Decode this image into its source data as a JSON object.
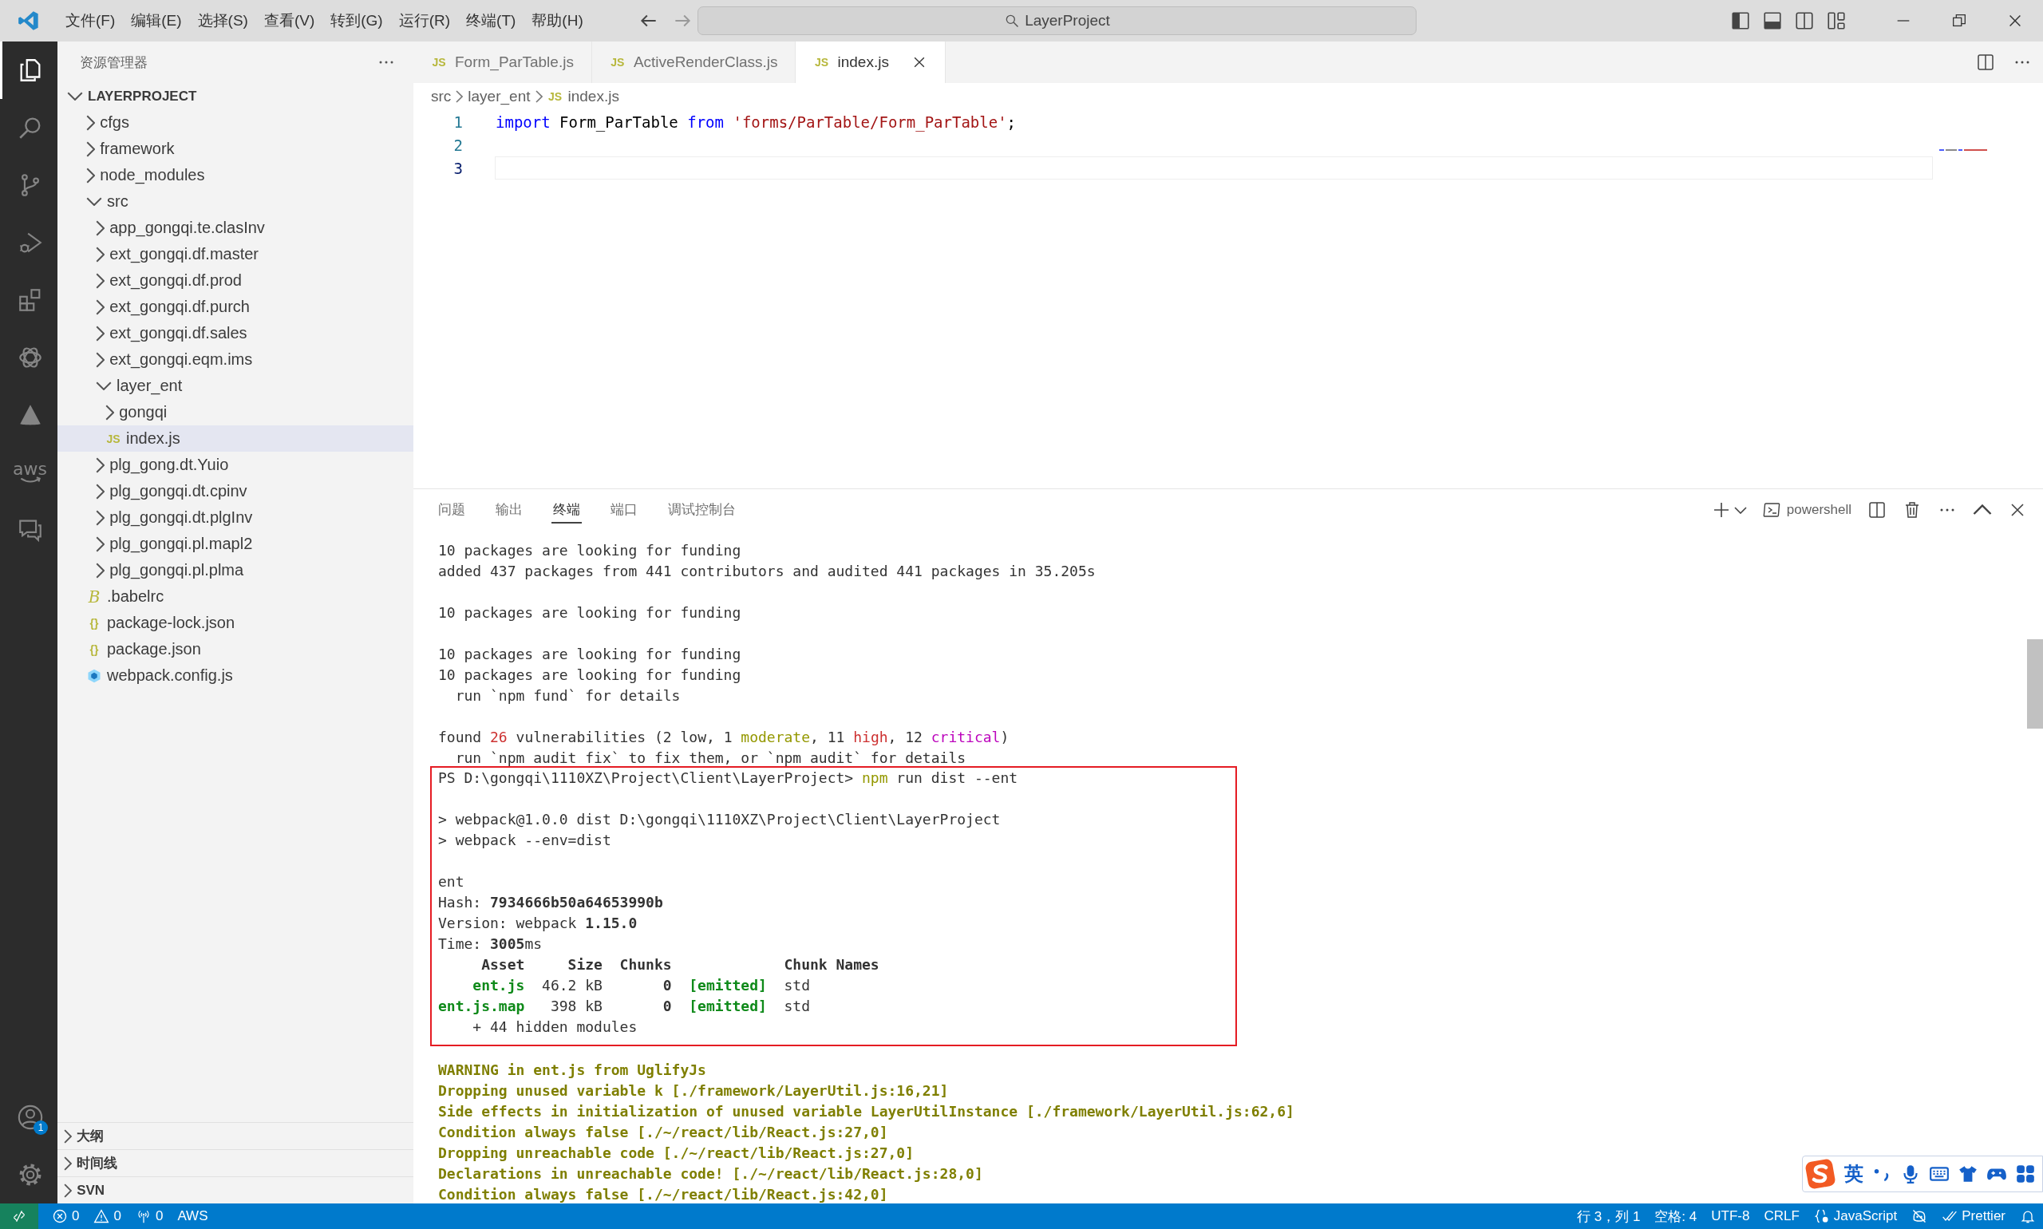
{
  "title_bar": {
    "menus": [
      "文件(F)",
      "编辑(E)",
      "选择(S)",
      "查看(V)",
      "转到(G)",
      "运行(R)",
      "终端(T)",
      "帮助(H)"
    ],
    "command_center": "LayerProject"
  },
  "activity_bar": {
    "items": [
      {
        "kind": "explorer",
        "selected": true
      },
      {
        "kind": "search",
        "selected": false
      },
      {
        "kind": "source-control",
        "selected": false
      },
      {
        "kind": "run-debug",
        "selected": false
      },
      {
        "kind": "extensions",
        "selected": false
      },
      {
        "kind": "knot",
        "selected": false
      },
      {
        "kind": "cone",
        "selected": false
      },
      {
        "kind": "aws",
        "label": "aws",
        "selected": false
      },
      {
        "kind": "chat",
        "selected": false
      }
    ],
    "account_badge": "1"
  },
  "sidebar": {
    "title": "资源管理器",
    "root": {
      "label": "LAYERPROJECT",
      "kind": "folder",
      "expanded": true,
      "selected": false,
      "children": [
        {
          "label": "cfgs",
          "kind": "folder",
          "expanded": false,
          "selected": false
        },
        {
          "label": "framework",
          "kind": "folder",
          "expanded": false,
          "selected": false
        },
        {
          "label": "node_modules",
          "kind": "folder",
          "expanded": false,
          "selected": false
        },
        {
          "label": "src",
          "kind": "folder",
          "expanded": true,
          "selected": false,
          "children": [
            {
              "label": "app_gongqi.te.clasInv",
              "kind": "folder",
              "expanded": false,
              "selected": false
            },
            {
              "label": "ext_gongqi.df.master",
              "kind": "folder",
              "expanded": false,
              "selected": false
            },
            {
              "label": "ext_gongqi.df.prod",
              "kind": "folder",
              "expanded": false,
              "selected": false
            },
            {
              "label": "ext_gongqi.df.purch",
              "kind": "folder",
              "expanded": false,
              "selected": false
            },
            {
              "label": "ext_gongqi.df.sales",
              "kind": "folder",
              "expanded": false,
              "selected": false
            },
            {
              "label": "ext_gongqi.eqm.ims",
              "kind": "folder",
              "expanded": false,
              "selected": false
            },
            {
              "label": "layer_ent",
              "kind": "folder",
              "expanded": true,
              "selected": false,
              "children": [
                {
                  "label": "gongqi",
                  "kind": "folder",
                  "expanded": false,
                  "selected": false
                },
                {
                  "label": "index.js",
                  "kind": "js",
                  "badge": "JS",
                  "selected": true
                }
              ]
            },
            {
              "label": "plg_gong.dt.Yuio",
              "kind": "folder",
              "expanded": false,
              "selected": false
            },
            {
              "label": "plg_gongqi.dt.cpinv",
              "kind": "folder",
              "expanded": false,
              "selected": false
            },
            {
              "label": "plg_gongqi.dt.plgInv",
              "kind": "folder",
              "expanded": false,
              "selected": false
            },
            {
              "label": "plg_gongqi.pl.mapl2",
              "kind": "folder",
              "expanded": false,
              "selected": false
            },
            {
              "label": "plg_gongqi.pl.plma",
              "kind": "folder",
              "expanded": false,
              "selected": false
            }
          ]
        },
        {
          "label": ".babelrc",
          "kind": "babel",
          "badge": "B",
          "selected": false
        },
        {
          "label": "package-lock.json",
          "kind": "json",
          "badge": "{}",
          "selected": false
        },
        {
          "label": "package.json",
          "kind": "json",
          "badge": "{}",
          "selected": false
        },
        {
          "label": "webpack.config.js",
          "kind": "webpack",
          "selected": false
        }
      ]
    },
    "sections": [
      {
        "label": "大纲",
        "expanded": false
      },
      {
        "label": "时间线",
        "expanded": false
      },
      {
        "label": "SVN",
        "expanded": false
      }
    ]
  },
  "editor": {
    "tabs": [
      {
        "label": "Form_ParTable.js",
        "badge": "JS",
        "selected": false
      },
      {
        "label": "ActiveRenderClass.js",
        "badge": "JS",
        "selected": false
      },
      {
        "label": "index.js",
        "badge": "JS",
        "selected": true
      }
    ],
    "breadcrumbs": [
      {
        "label": "src"
      },
      {
        "label": "layer_ent"
      },
      {
        "label": "index.js",
        "badge": "JS"
      }
    ],
    "lines": [
      {
        "number": "1",
        "current": false,
        "tokens": [
          {
            "text": "import",
            "kind": "keyword"
          },
          {
            "text": " Form_ParTable ",
            "kind": "plain"
          },
          {
            "text": "from",
            "kind": "keyword"
          },
          {
            "text": " 'forms/ParTable/Form_ParTable'",
            "kind": "string"
          },
          {
            "text": ";",
            "kind": "plain"
          }
        ]
      },
      {
        "number": "2",
        "current": false
      },
      {
        "number": "3",
        "current": true
      }
    ]
  },
  "panel": {
    "tabs": [
      {
        "label": "问题",
        "selected": false
      },
      {
        "label": "输出",
        "selected": false
      },
      {
        "label": "终端",
        "selected": true
      },
      {
        "label": "端口",
        "selected": false
      },
      {
        "label": "调试控制台",
        "selected": false
      }
    ],
    "terminal_name": "powershell",
    "groups": [
      {
        "kind": "plain",
        "lines": [
          {
            "kind": "text",
            "segments": [
              {
                "text": "10 packages are looking for funding",
                "kind": "text"
              }
            ]
          },
          {
            "kind": "text",
            "segments": [
              {
                "text": "added 437 packages from 441 contributors and audited 441 packages in 35.205s",
                "kind": "text"
              }
            ]
          },
          {
            "kind": "blank"
          },
          {
            "kind": "text",
            "segments": [
              {
                "text": "10 packages are looking for funding",
                "kind": "text"
              }
            ]
          },
          {
            "kind": "blank"
          },
          {
            "kind": "text",
            "segments": [
              {
                "text": "10 packages are looking for funding",
                "kind": "text"
              }
            ]
          },
          {
            "kind": "text",
            "segments": [
              {
                "text": "10 packages are looking for funding",
                "kind": "text"
              }
            ]
          },
          {
            "kind": "text",
            "segments": [
              {
                "text": "  run `npm fund` for details",
                "kind": "text"
              }
            ]
          },
          {
            "kind": "blank"
          },
          {
            "kind": "text",
            "segments": [
              {
                "text": "found ",
                "kind": "text"
              },
              {
                "text": "26",
                "kind": "red"
              },
              {
                "text": " vulnerabilities (2 low, 1 ",
                "kind": "text"
              },
              {
                "text": "moderate",
                "kind": "olive"
              },
              {
                "text": ", 11 ",
                "kind": "text"
              },
              {
                "text": "high",
                "kind": "red"
              },
              {
                "text": ", 12 ",
                "kind": "text"
              },
              {
                "text": "critical",
                "kind": "magenta"
              },
              {
                "text": ")",
                "kind": "text"
              }
            ]
          },
          {
            "kind": "text",
            "segments": [
              {
                "text": "  run `npm audit fix` to fix them, or `npm audit` for details",
                "kind": "text"
              }
            ]
          }
        ]
      },
      {
        "kind": "boxed",
        "lines": [
          {
            "kind": "text",
            "segments": [
              {
                "text": "PS D:\\gongqi\\1110XZ\\Project\\Client\\LayerProject> ",
                "kind": "text"
              },
              {
                "text": "npm",
                "kind": "olive"
              },
              {
                "text": " run dist --ent",
                "kind": "text"
              }
            ]
          },
          {
            "kind": "blank"
          },
          {
            "kind": "text",
            "segments": [
              {
                "text": "> webpack@1.0.0 dist D:\\gongqi\\1110XZ\\Project\\Client\\LayerProject",
                "kind": "text"
              }
            ]
          },
          {
            "kind": "text",
            "segments": [
              {
                "text": "> webpack --env=dist",
                "kind": "text"
              }
            ]
          },
          {
            "kind": "blank"
          },
          {
            "kind": "text",
            "segments": [
              {
                "text": "ent",
                "kind": "text"
              }
            ]
          },
          {
            "kind": "text",
            "segments": [
              {
                "text": "Hash: ",
                "kind": "text"
              },
              {
                "text": "7934666b50a64653990b",
                "kind": "strong"
              }
            ]
          },
          {
            "kind": "text",
            "segments": [
              {
                "text": "Version: webpack ",
                "kind": "text"
              },
              {
                "text": "1.15.0",
                "kind": "strong"
              }
            ]
          },
          {
            "kind": "text",
            "segments": [
              {
                "text": "Time: ",
                "kind": "text"
              },
              {
                "text": "3005",
                "kind": "strong"
              },
              {
                "text": "ms",
                "kind": "text"
              }
            ]
          },
          {
            "kind": "text",
            "segments": [
              {
                "text": "     Asset     Size  Chunks             Chunk Names",
                "kind": "strong"
              }
            ]
          },
          {
            "kind": "text",
            "segments": [
              {
                "text": "    ent.js",
                "kind": "green"
              },
              {
                "text": "  46.2 kB       ",
                "kind": "text"
              },
              {
                "text": "0",
                "kind": "strong"
              },
              {
                "text": "  [emitted]",
                "kind": "green"
              },
              {
                "text": "  std",
                "kind": "text"
              }
            ]
          },
          {
            "kind": "text",
            "segments": [
              {
                "text": "ent.js.map",
                "kind": "green"
              },
              {
                "text": "   398 kB       ",
                "kind": "text"
              },
              {
                "text": "0",
                "kind": "strong"
              },
              {
                "text": "  [emitted]",
                "kind": "green"
              },
              {
                "text": "  std",
                "kind": "text"
              }
            ]
          },
          {
            "kind": "text",
            "segments": [
              {
                "text": "    + 44 hidden modules",
                "kind": "text"
              }
            ]
          }
        ]
      },
      {
        "kind": "plain",
        "lines": [
          {
            "kind": "blank"
          },
          {
            "kind": "text",
            "segments": [
              {
                "text": "WARNING in ent.js from UglifyJs",
                "kind": "warning"
              }
            ]
          },
          {
            "kind": "text",
            "segments": [
              {
                "text": "Dropping unused variable k [./framework/LayerUtil.js:16,21]",
                "kind": "warning"
              }
            ]
          },
          {
            "kind": "text",
            "segments": [
              {
                "text": "Side effects in initialization of unused variable LayerUtilInstance [./framework/LayerUtil.js:62,6]",
                "kind": "warning"
              }
            ]
          },
          {
            "kind": "text",
            "segments": [
              {
                "text": "Condition always false [./~/react/lib/React.js:27,0]",
                "kind": "warning"
              }
            ]
          },
          {
            "kind": "text",
            "segments": [
              {
                "text": "Dropping unreachable code [./~/react/lib/React.js:27,0]",
                "kind": "warning"
              }
            ]
          },
          {
            "kind": "text",
            "segments": [
              {
                "text": "Declarations in unreachable code! [./~/react/lib/React.js:28,0]",
                "kind": "warning"
              }
            ]
          },
          {
            "kind": "text",
            "segments": [
              {
                "text": "Condition always false [./~/react/lib/React.js:42,0]",
                "kind": "warning"
              }
            ]
          }
        ]
      }
    ]
  },
  "ime_bar": {
    "mode": "英"
  },
  "status_bar": {
    "left": [
      {
        "kind": "remote"
      },
      {
        "kind": "errors",
        "text": "0"
      },
      {
        "kind": "warnings",
        "text": "0"
      },
      {
        "kind": "ports",
        "text": "0"
      },
      {
        "kind": "text",
        "text": "AWS"
      }
    ],
    "right": [
      {
        "kind": "text",
        "text": "行 3，列 1"
      },
      {
        "kind": "text",
        "text": "空格: 4"
      },
      {
        "kind": "text",
        "text": "UTF-8"
      },
      {
        "kind": "text",
        "text": "CRLF"
      },
      {
        "kind": "language",
        "text": "JavaScript"
      },
      {
        "kind": "copilot-off"
      },
      {
        "kind": "prettier",
        "text": "Prettier"
      },
      {
        "kind": "bell"
      }
    ]
  }
}
